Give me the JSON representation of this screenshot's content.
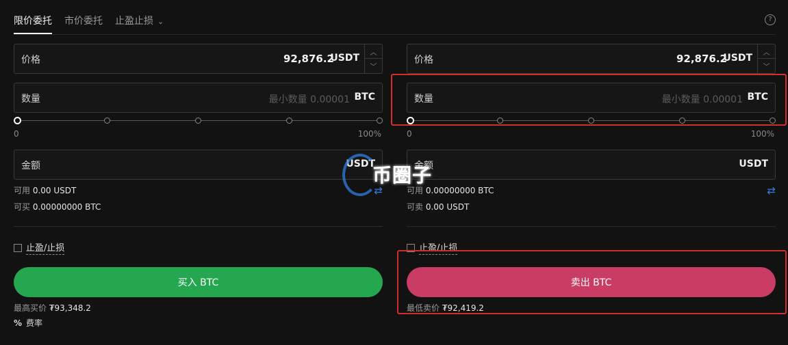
{
  "tabs": [
    {
      "label": "限价委托",
      "active": true
    },
    {
      "label": "市价委托",
      "active": false
    },
    {
      "label": "止盈止损",
      "active": false
    }
  ],
  "buy": {
    "price_label": "价格",
    "price_value": "92,876.2",
    "price_unit": "USDT",
    "qty_label": "数量",
    "qty_placeholder": "最小数量 0.00001",
    "qty_unit": "BTC",
    "slider_min": "0",
    "slider_max": "100%",
    "slider_value": 0,
    "amount_label": "金额",
    "amount_unit": "USDT",
    "avail_label": "可用",
    "avail_value": "0.00 USDT",
    "can_label": "可买",
    "can_value": "0.00000000 BTC",
    "tpsl_label": "止盈/止损",
    "button_label": "买入 BTC",
    "best_label": "最高买价",
    "best_value": "₮93,348.2"
  },
  "sell": {
    "price_label": "价格",
    "price_value": "92,876.2",
    "price_unit": "USDT",
    "qty_label": "数量",
    "qty_placeholder": "最小数量 0.00001",
    "qty_unit": "BTC",
    "slider_min": "0",
    "slider_max": "100%",
    "slider_value": 0,
    "amount_label": "金额",
    "amount_unit": "USDT",
    "avail_label": "可用",
    "avail_value": "0.00000000 BTC",
    "can_label": "可卖",
    "can_value": "0.00 USDT",
    "tpsl_label": "止盈/止损",
    "button_label": "卖出 BTC",
    "best_label": "最低卖价",
    "best_value": "₮92,419.2"
  },
  "fee": {
    "icon": "%",
    "label": "费率"
  },
  "watermark": "币圈子",
  "colors": {
    "buy": "#25a750",
    "sell": "#c93c63",
    "highlight": "#d0302a",
    "swap": "#3a7be8"
  }
}
